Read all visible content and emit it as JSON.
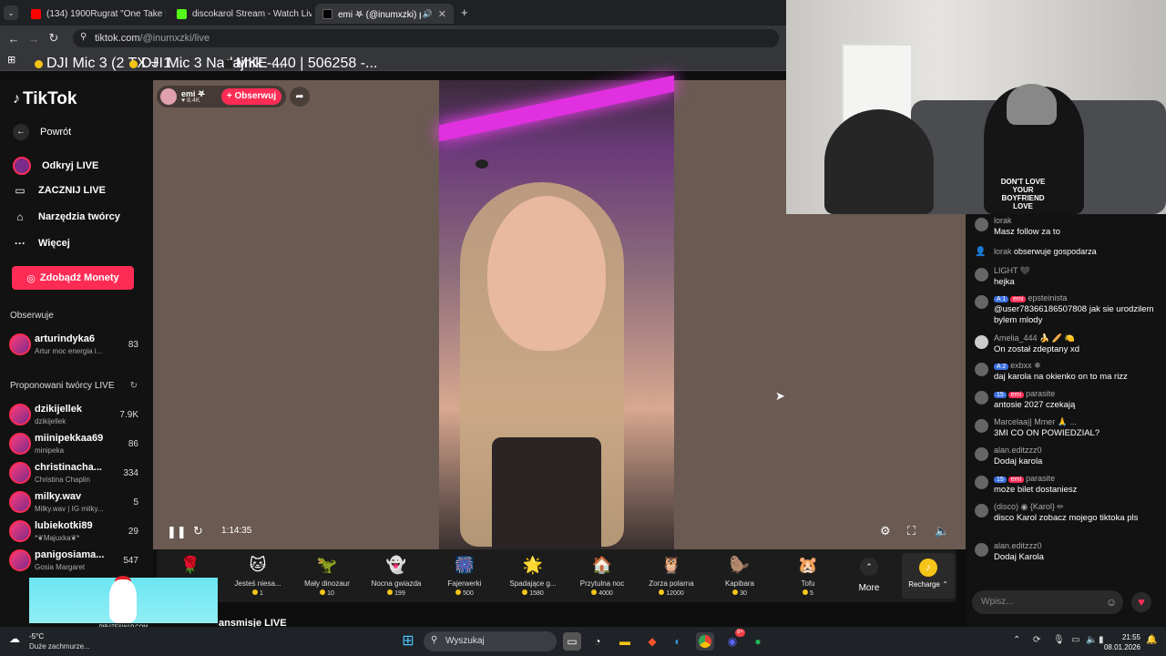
{
  "browser": {
    "tabs": [
      {
        "label": "(134) 1900Rugrat \"One Take Fre",
        "color": "#ff0000"
      },
      {
        "label": "discokarol Stream - Watch Live",
        "color": "#53fc18"
      },
      {
        "label": "emi 𖤐 (@inumxzki) prowadz",
        "color": "#000000"
      }
    ],
    "new_tab": "+",
    "url_host": "tiktok.com",
    "url_path": "/@inumxzki/live",
    "bookmarks": [
      "DJI Mic 3 (2 TX + 1...",
      "DJI Mic 3 Nadajnik -...",
      "MKE 440 | 506258 -..."
    ]
  },
  "sidebar": {
    "logo": "TikTok",
    "back": "Powrót",
    "nav": [
      {
        "label": "Odkryj LIVE",
        "icon": "live-icon"
      },
      {
        "label": "ZACZNIJ LIVE",
        "icon": "camera-icon"
      },
      {
        "label": "Narzędzia twórcy",
        "icon": "home-icon"
      },
      {
        "label": "Więcej",
        "icon": "more-icon"
      }
    ],
    "coins_button": "Zdobądź Monety",
    "following_title": "Obserwuje",
    "following": [
      {
        "name": "arturindyka6",
        "sub": "Artur moc energia i...",
        "count": "83"
      }
    ],
    "suggested_title": "Proponowani twórcy LIVE",
    "suggested": [
      {
        "name": "dzikijellek",
        "sub": "dzikijellek",
        "count": "7.9K"
      },
      {
        "name": "miinipekkaa69",
        "sub": "minipeka",
        "count": "86"
      },
      {
        "name": "christinacha...",
        "sub": "Christina Chaplin",
        "count": "334"
      },
      {
        "name": "milky.wav",
        "sub": "Milky.wav | IG milky...",
        "count": "5"
      },
      {
        "name": "lubiekotki89",
        "sub": "*❦Majuxka❦*",
        "count": "29"
      },
      {
        "name": "panigosiama...",
        "sub": "Gosia Margaret",
        "count": "547"
      }
    ]
  },
  "live": {
    "host_name": "emi 𖤐",
    "host_likes": "8.4K",
    "follow_label": "+ Obserwuj",
    "elapsed": "1:14:35",
    "more_label": "More",
    "recharge_label": "Recharge ⌃",
    "bottom_text": "ansmisje LIVE"
  },
  "gifts": [
    {
      "name": "",
      "price": "",
      "icon": "🌹"
    },
    {
      "name": "Jesteś niesa...",
      "price": "1",
      "icon": "🐱"
    },
    {
      "name": "Mały dinozaur",
      "price": "10",
      "icon": "🦖"
    },
    {
      "name": "Nocna gwiazda",
      "price": "199",
      "icon": "👻"
    },
    {
      "name": "Fajerwerki",
      "price": "500",
      "icon": "🎆"
    },
    {
      "name": "Spadające g...",
      "price": "1580",
      "icon": "🌟"
    },
    {
      "name": "Przytulna noc",
      "price": "4000",
      "icon": "🏠"
    },
    {
      "name": "Zorza polarna",
      "price": "12000",
      "icon": "🦉"
    },
    {
      "name": "Kapibara",
      "price": "30",
      "icon": "🦫"
    },
    {
      "name": "Tofu",
      "price": "5",
      "icon": "🐹"
    }
  ],
  "webcam": {
    "shirt_text": "DON'T LOVE YOUR BOYFRIEND LOVE"
  },
  "chat": {
    "messages": [
      {
        "user": "lorak",
        "text": "Masz follow za to",
        "badges": []
      },
      {
        "user": "lorak",
        "text": "obserwuje gospodarza",
        "badges": [],
        "inline": true
      },
      {
        "user": "LIGHT 🖤",
        "text": "hejka",
        "badges": []
      },
      {
        "user": "epsteinista",
        "text": "@user78366186507808 jak sie urodzilem bylem mlody",
        "badges": [
          "A 1",
          "emi"
        ]
      },
      {
        "user": "Amelia_444 🍌 🥖 🍋",
        "text": "On został zdeptany xd",
        "badges": []
      },
      {
        "user": "exbxx ❄",
        "text": "daj karola na okienko on to ma rizz",
        "badges": [
          "A 2"
        ]
      },
      {
        "user": "parasite",
        "text": "antosie 2027 czekają",
        "badges": [
          "15",
          "emi"
        ]
      },
      {
        "user": "Marcelaa|| Mmer 🙏 ...",
        "text": "3MI CO ON POWIEDZIAL?",
        "badges": []
      },
      {
        "user": "alan.editzzz0",
        "text": "Dodaj karola",
        "badges": []
      },
      {
        "user": "parasite",
        "text": "może bilet dostaniesz",
        "badges": [
          "15",
          "emi"
        ]
      },
      {
        "user": "(disco) ◉ {Karol} ✏",
        "text": "disco Karol zobacz mojego tiktoka pls",
        "badges": []
      },
      {
        "user": "alan.editzzz0",
        "text": "Dodaj Karola",
        "badges": []
      }
    ],
    "input_placeholder": "Wpisz..."
  },
  "ad": {
    "brand": "PIRATESWAP.COM"
  },
  "taskbar": {
    "weather_temp": "-5°C",
    "weather_desc": "Duże zachmurze...",
    "search": "Wyszukaj",
    "time": "21:55",
    "date": "08.01.2026",
    "discord_badge": "9+"
  },
  "colors": {
    "accent": "#fe2c55",
    "chrome_bg": "#202124",
    "stage_bg": "#6a5a52"
  }
}
